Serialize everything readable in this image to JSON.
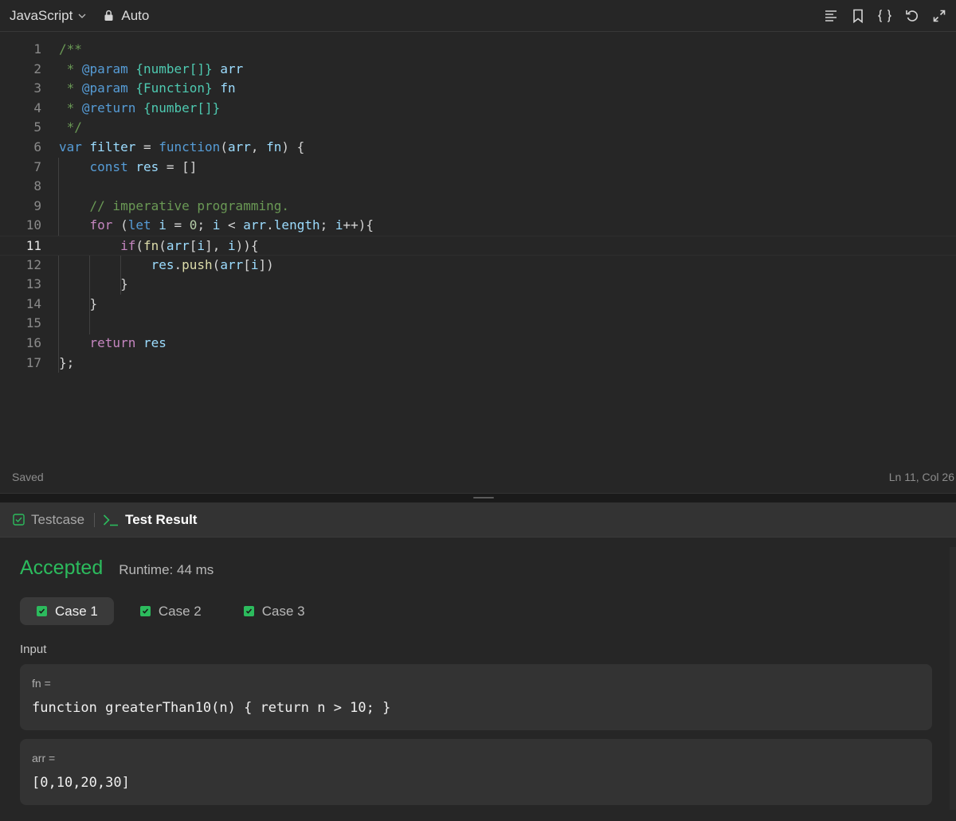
{
  "editor": {
    "language": "JavaScript",
    "mode": "Auto",
    "toolbar_icons": [
      "format-icon",
      "bookmark-icon",
      "braces-icon",
      "reset-icon",
      "expand-icon"
    ],
    "lines": [
      {
        "n": "1",
        "tokens": [
          [
            "t-comment",
            "/**"
          ]
        ]
      },
      {
        "n": "2",
        "tokens": [
          [
            "t-comment",
            " * "
          ],
          [
            "t-doc",
            "@param"
          ],
          [
            "t-comment",
            " "
          ],
          [
            "t-type",
            "{number[]}"
          ],
          [
            "t-comment",
            " "
          ],
          [
            "t-var",
            "arr"
          ]
        ]
      },
      {
        "n": "3",
        "tokens": [
          [
            "t-comment",
            " * "
          ],
          [
            "t-doc",
            "@param"
          ],
          [
            "t-comment",
            " "
          ],
          [
            "t-type",
            "{Function}"
          ],
          [
            "t-comment",
            " "
          ],
          [
            "t-var",
            "fn"
          ]
        ]
      },
      {
        "n": "4",
        "tokens": [
          [
            "t-comment",
            " * "
          ],
          [
            "t-doc",
            "@return"
          ],
          [
            "t-comment",
            " "
          ],
          [
            "t-type",
            "{number[]}"
          ]
        ]
      },
      {
        "n": "5",
        "tokens": [
          [
            "t-comment",
            " */"
          ]
        ]
      },
      {
        "n": "6",
        "tokens": [
          [
            "t-kw",
            "var"
          ],
          [
            "t-punc",
            " "
          ],
          [
            "t-var",
            "filter"
          ],
          [
            "t-punc",
            " = "
          ],
          [
            "t-kw",
            "function"
          ],
          [
            "t-punc",
            "("
          ],
          [
            "t-var",
            "arr"
          ],
          [
            "t-punc",
            ", "
          ],
          [
            "t-var",
            "fn"
          ],
          [
            "t-punc",
            ") {"
          ]
        ]
      },
      {
        "n": "7",
        "tokens": [
          [
            "t-punc",
            "    "
          ],
          [
            "t-kw",
            "const"
          ],
          [
            "t-punc",
            " "
          ],
          [
            "t-var",
            "res"
          ],
          [
            "t-punc",
            " = []"
          ]
        ]
      },
      {
        "n": "8",
        "tokens": []
      },
      {
        "n": "9",
        "tokens": [
          [
            "t-punc",
            "    "
          ],
          [
            "t-comment",
            "// imperative programming."
          ]
        ]
      },
      {
        "n": "10",
        "tokens": [
          [
            "t-punc",
            "    "
          ],
          [
            "t-ctrl",
            "for"
          ],
          [
            "t-punc",
            " ("
          ],
          [
            "t-kw",
            "let"
          ],
          [
            "t-punc",
            " "
          ],
          [
            "t-var",
            "i"
          ],
          [
            "t-punc",
            " = "
          ],
          [
            "t-num",
            "0"
          ],
          [
            "t-punc",
            "; "
          ],
          [
            "t-var",
            "i"
          ],
          [
            "t-punc",
            " < "
          ],
          [
            "t-var",
            "arr"
          ],
          [
            "t-punc",
            "."
          ],
          [
            "t-var",
            "length"
          ],
          [
            "t-punc",
            "; "
          ],
          [
            "t-var",
            "i"
          ],
          [
            "t-punc",
            "++){"
          ]
        ]
      },
      {
        "n": "11",
        "tokens": [
          [
            "t-punc",
            "        "
          ],
          [
            "t-ctrl",
            "if"
          ],
          [
            "t-punc",
            "("
          ],
          [
            "t-fn",
            "fn"
          ],
          [
            "t-punc",
            "("
          ],
          [
            "t-var",
            "arr"
          ],
          [
            "t-punc",
            "["
          ],
          [
            "t-var",
            "i"
          ],
          [
            "t-punc",
            "], "
          ],
          [
            "t-var",
            "i"
          ],
          [
            "t-punc",
            ")){"
          ]
        ]
      },
      {
        "n": "12",
        "tokens": [
          [
            "t-punc",
            "            "
          ],
          [
            "t-var",
            "res"
          ],
          [
            "t-punc",
            "."
          ],
          [
            "t-fn",
            "push"
          ],
          [
            "t-punc",
            "("
          ],
          [
            "t-var",
            "arr"
          ],
          [
            "t-punc",
            "["
          ],
          [
            "t-var",
            "i"
          ],
          [
            "t-punc",
            "])"
          ]
        ]
      },
      {
        "n": "13",
        "tokens": [
          [
            "t-punc",
            "        }"
          ]
        ]
      },
      {
        "n": "14",
        "tokens": [
          [
            "t-punc",
            "    }"
          ]
        ]
      },
      {
        "n": "15",
        "tokens": []
      },
      {
        "n": "16",
        "tokens": [
          [
            "t-punc",
            "    "
          ],
          [
            "t-ctrl",
            "return"
          ],
          [
            "t-punc",
            " "
          ],
          [
            "t-var",
            "res"
          ]
        ]
      },
      {
        "n": "17",
        "tokens": [
          [
            "t-punc",
            "};"
          ]
        ]
      }
    ],
    "active_line": "11",
    "status_saved": "Saved",
    "cursor_position": "Ln 11, Col 26"
  },
  "panel": {
    "tabs": [
      {
        "label": "Testcase",
        "active": false
      },
      {
        "label": "Test Result",
        "active": true
      }
    ],
    "result": {
      "status": "Accepted",
      "status_color": "#2cbb5d",
      "runtime": "Runtime: 44 ms"
    },
    "cases": [
      {
        "label": "Case 1",
        "active": true
      },
      {
        "label": "Case 2",
        "active": false
      },
      {
        "label": "Case 3",
        "active": false
      }
    ],
    "input_label": "Input",
    "params": [
      {
        "name": "fn =",
        "value": "function greaterThan10(n) { return n > 10; }"
      },
      {
        "name": "arr =",
        "value": "[0,10,20,30]"
      }
    ]
  }
}
